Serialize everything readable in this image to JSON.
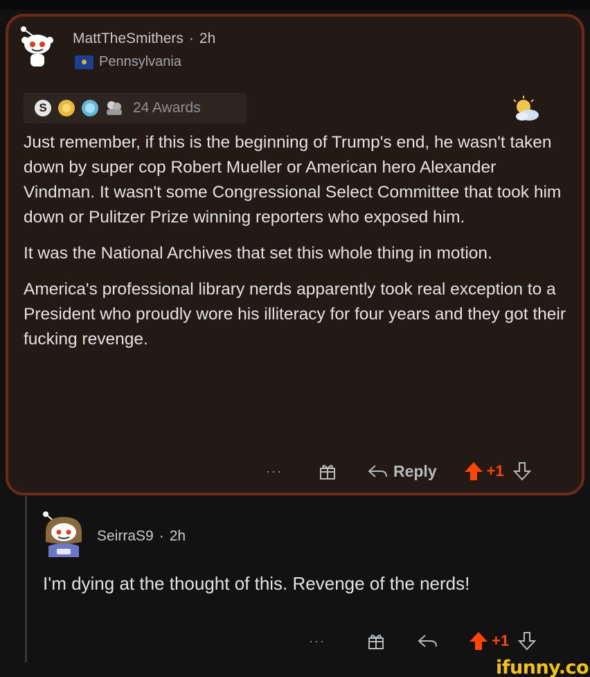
{
  "comment": {
    "username": "MattTheSmithers",
    "time": "2h",
    "separator": "·",
    "flair": "Pennsylvania",
    "awards_count_label": "24 Awards",
    "award_icons": [
      "silver-award-icon",
      "gold-award-icon",
      "helpful-award-icon",
      "wholesome-hands-award-icon"
    ],
    "paragraphs": [
      "Just remember, if this is the beginning of Trump's end, he wasn't taken down by super cop Robert Mueller or American hero Alexander Vindman. It wasn't some Congressional Select Committee that took him down or Pulitzer Prize winning reporters who exposed him.",
      "It was the National Archives that set this whole thing in motion.",
      "America's professional library nerds apparently took real exception to a President who proudly wore his illiteracy for four years and they got their fucking revenge."
    ],
    "actions": {
      "more": "···",
      "reply_label": "Reply",
      "score": "+1"
    }
  },
  "reply": {
    "username": "SeirraS9",
    "time": "2h",
    "separator": "·",
    "text": "I'm dying at the thought of this. Revenge of the nerds!",
    "actions": {
      "more": "···",
      "score": "+1"
    }
  },
  "watermark": "ifunny.co",
  "colors": {
    "background": "#121212",
    "card": "#231915",
    "card_border": "#6e2a17",
    "upvote": "#ff4500",
    "watermark": "#f2c40f"
  }
}
